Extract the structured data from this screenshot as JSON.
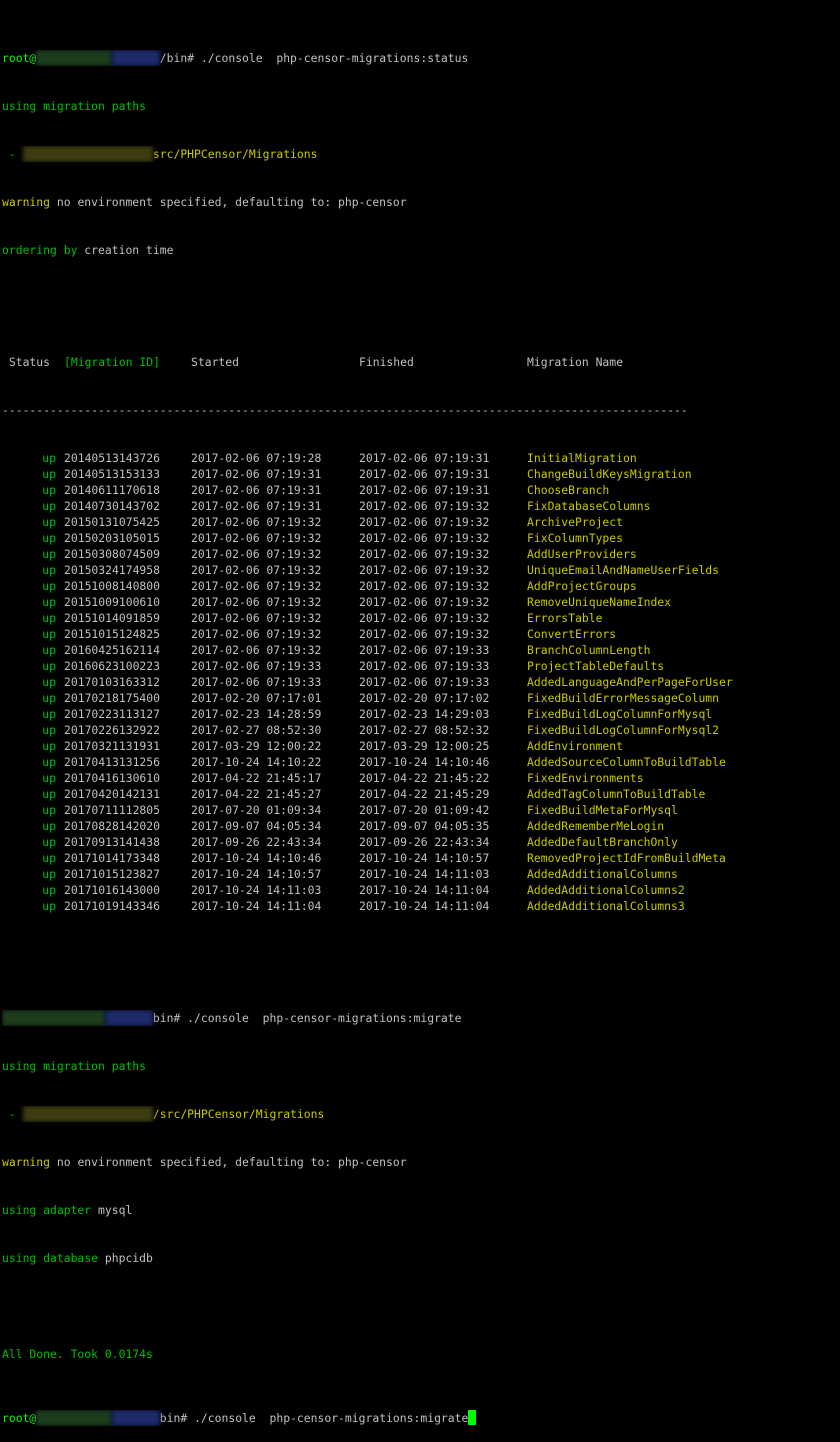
{
  "colors": {
    "background": "#000000",
    "green": "#00ff00",
    "yellow": "#ffff00",
    "text": "#c0c0c0"
  },
  "prompt1": {
    "user": "root@",
    "dir_end": "/bin",
    "symbol": "#",
    "command": " ./console  php-censor-migrations:status"
  },
  "info1": {
    "using_paths": "using migration paths",
    "path_prefix": " - ",
    "path_suffix": "src/PHPCensor/Migrations",
    "warning_word": "warning",
    "warning_rest": " no environment specified, defaulting to: php-censor",
    "ordering_word": "ordering by",
    "ordering_rest": " creation time"
  },
  "table": {
    "headers": {
      "status": " Status",
      "id": "[Migration ID]",
      "started": "Started",
      "finished": "Finished",
      "name": "Migration Name"
    },
    "separator": "----------------------------------------------------------------------------------------------------",
    "rows": [
      {
        "status": "up",
        "id": "20140513143726",
        "started": "2017-02-06 07:19:28",
        "finished": "2017-02-06 07:19:31",
        "name": "InitialMigration"
      },
      {
        "status": "up",
        "id": "20140513153133",
        "started": "2017-02-06 07:19:31",
        "finished": "2017-02-06 07:19:31",
        "name": "ChangeBuildKeysMigration"
      },
      {
        "status": "up",
        "id": "20140611170618",
        "started": "2017-02-06 07:19:31",
        "finished": "2017-02-06 07:19:31",
        "name": "ChooseBranch"
      },
      {
        "status": "up",
        "id": "20140730143702",
        "started": "2017-02-06 07:19:31",
        "finished": "2017-02-06 07:19:32",
        "name": "FixDatabaseColumns"
      },
      {
        "status": "up",
        "id": "20150131075425",
        "started": "2017-02-06 07:19:32",
        "finished": "2017-02-06 07:19:32",
        "name": "ArchiveProject"
      },
      {
        "status": "up",
        "id": "20150203105015",
        "started": "2017-02-06 07:19:32",
        "finished": "2017-02-06 07:19:32",
        "name": "FixColumnTypes"
      },
      {
        "status": "up",
        "id": "20150308074509",
        "started": "2017-02-06 07:19:32",
        "finished": "2017-02-06 07:19:32",
        "name": "AddUserProviders"
      },
      {
        "status": "up",
        "id": "20150324174958",
        "started": "2017-02-06 07:19:32",
        "finished": "2017-02-06 07:19:32",
        "name": "UniqueEmailAndNameUserFields"
      },
      {
        "status": "up",
        "id": "20151008140800",
        "started": "2017-02-06 07:19:32",
        "finished": "2017-02-06 07:19:32",
        "name": "AddProjectGroups"
      },
      {
        "status": "up",
        "id": "20151009100610",
        "started": "2017-02-06 07:19:32",
        "finished": "2017-02-06 07:19:32",
        "name": "RemoveUniqueNameIndex"
      },
      {
        "status": "up",
        "id": "20151014091859",
        "started": "2017-02-06 07:19:32",
        "finished": "2017-02-06 07:19:32",
        "name": "ErrorsTable"
      },
      {
        "status": "up",
        "id": "20151015124825",
        "started": "2017-02-06 07:19:32",
        "finished": "2017-02-06 07:19:32",
        "name": "ConvertErrors"
      },
      {
        "status": "up",
        "id": "20160425162114",
        "started": "2017-02-06 07:19:32",
        "finished": "2017-02-06 07:19:33",
        "name": "BranchColumnLength"
      },
      {
        "status": "up",
        "id": "20160623100223",
        "started": "2017-02-06 07:19:33",
        "finished": "2017-02-06 07:19:33",
        "name": "ProjectTableDefaults"
      },
      {
        "status": "up",
        "id": "20170103163312",
        "started": "2017-02-06 07:19:33",
        "finished": "2017-02-06 07:19:33",
        "name": "AddedLanguageAndPerPageForUser"
      },
      {
        "status": "up",
        "id": "20170218175400",
        "started": "2017-02-20 07:17:01",
        "finished": "2017-02-20 07:17:02",
        "name": "FixedBuildErrorMessageColumn"
      },
      {
        "status": "up",
        "id": "20170223113127",
        "started": "2017-02-23 14:28:59",
        "finished": "2017-02-23 14:29:03",
        "name": "FixedBuildLogColumnForMysql"
      },
      {
        "status": "up",
        "id": "20170226132922",
        "started": "2017-02-27 08:52:30",
        "finished": "2017-02-27 08:52:32",
        "name": "FixedBuildLogColumnForMysql2"
      },
      {
        "status": "up",
        "id": "20170321131931",
        "started": "2017-03-29 12:00:22",
        "finished": "2017-03-29 12:00:25",
        "name": "AddEnvironment"
      },
      {
        "status": "up",
        "id": "20170413131256",
        "started": "2017-10-24 14:10:22",
        "finished": "2017-10-24 14:10:46",
        "name": "AddedSourceColumnToBuildTable"
      },
      {
        "status": "up",
        "id": "20170416130610",
        "started": "2017-04-22 21:45:17",
        "finished": "2017-04-22 21:45:22",
        "name": "FixedEnvironments"
      },
      {
        "status": "up",
        "id": "20170420142131",
        "started": "2017-04-22 21:45:27",
        "finished": "2017-04-22 21:45:29",
        "name": "AddedTagColumnToBuildTable"
      },
      {
        "status": "up",
        "id": "20170711112805",
        "started": "2017-07-20 01:09:34",
        "finished": "2017-07-20 01:09:42",
        "name": "FixedBuildMetaForMysql"
      },
      {
        "status": "up",
        "id": "20170828142020",
        "started": "2017-09-07 04:05:34",
        "finished": "2017-09-07 04:05:35",
        "name": "AddedRememberMeLogin"
      },
      {
        "status": "up",
        "id": "20170913141438",
        "started": "2017-09-26 22:43:34",
        "finished": "2017-09-26 22:43:34",
        "name": "AddedDefaultBranchOnly"
      },
      {
        "status": "up",
        "id": "20171014173348",
        "started": "2017-10-24 14:10:46",
        "finished": "2017-10-24 14:10:57",
        "name": "RemovedProjectIdFromBuildMeta"
      },
      {
        "status": "up",
        "id": "20171015123827",
        "started": "2017-10-24 14:10:57",
        "finished": "2017-10-24 14:11:03",
        "name": "AddedAdditionalColumns"
      },
      {
        "status": "up",
        "id": "20171016143000",
        "started": "2017-10-24 14:11:03",
        "finished": "2017-10-24 14:11:04",
        "name": "AddedAdditionalColumns2"
      },
      {
        "status": "up",
        "id": "20171019143346",
        "started": "2017-10-24 14:11:04",
        "finished": "2017-10-24 14:11:04",
        "name": "AddedAdditionalColumns3"
      }
    ]
  },
  "prompt2": {
    "dir_end": "bin",
    "symbol": "#",
    "command": " ./console  php-censor-migrations:migrate"
  },
  "info2": {
    "using_paths": "using migration paths",
    "path_prefix": " - ",
    "path_suffix": "/src/PHPCensor/Migrations",
    "warning_word": "warning",
    "warning_rest": " no environment specified, defaulting to: php-censor",
    "adapter_word": "using adapter",
    "adapter_value": " mysql",
    "database_word": "using database",
    "database_value": " phpcidb"
  },
  "done": "All Done. Took 0.0174s",
  "prompt3": {
    "user": "root@",
    "dir_end": "bin",
    "symbol": "#",
    "command": " ./console  php-censor-migrations:migrate"
  }
}
